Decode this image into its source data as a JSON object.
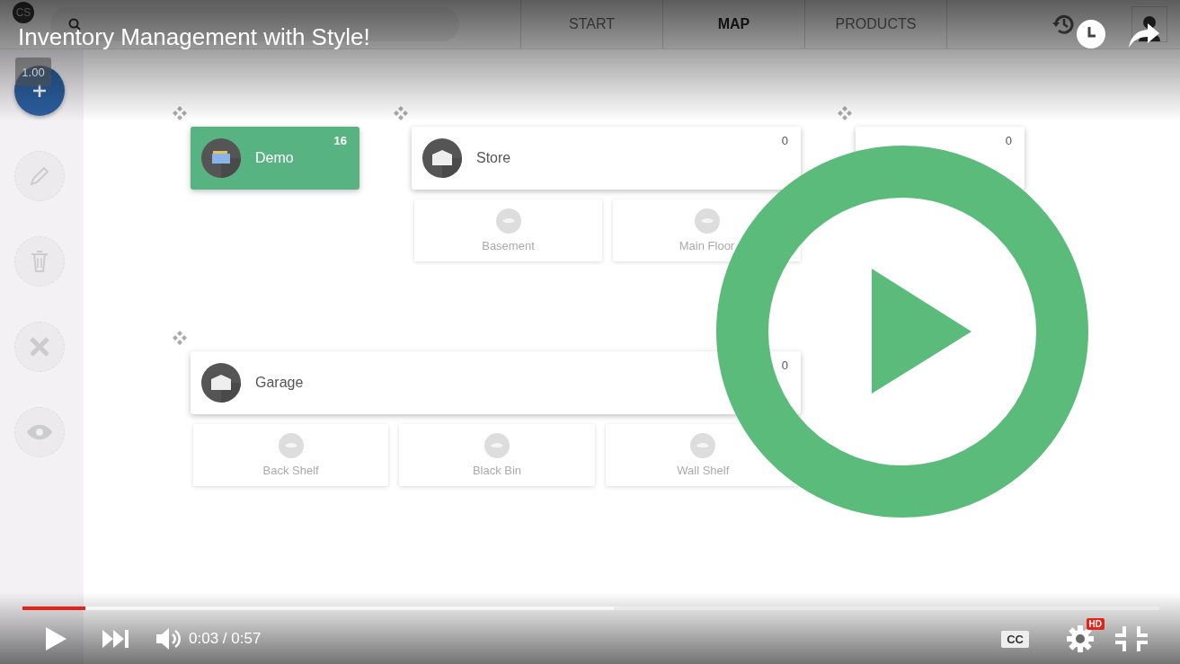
{
  "video": {
    "title": "Inventory Management with Style!",
    "speed_badge": "1.00"
  },
  "app": {
    "avatar": "CS",
    "tabs": [
      {
        "label": "START",
        "selected": false
      },
      {
        "label": "MAP",
        "selected": true
      },
      {
        "label": "PRODUCTS",
        "selected": false
      }
    ],
    "rows": [
      [
        {
          "name": "Demo",
          "count": "16",
          "selected": true
        },
        {
          "name": "Store",
          "count": "0",
          "selected": false,
          "children": [
            {
              "name": "Basement"
            },
            {
              "name": "Main Floor"
            }
          ]
        },
        {
          "count": "0",
          "selected": false
        }
      ],
      [
        {
          "name": "Garage",
          "count": "0",
          "selected": false,
          "children": [
            {
              "name": "Back Shelf"
            },
            {
              "name": "Black Bin"
            },
            {
              "name": "Wall Shelf"
            }
          ]
        }
      ]
    ]
  },
  "player": {
    "progress": {
      "level": 0.055
    },
    "buffer": {
      "level": 0.52
    },
    "time": "0:03 / 0:57",
    "cc": "CC",
    "hd_badge": "HD"
  }
}
